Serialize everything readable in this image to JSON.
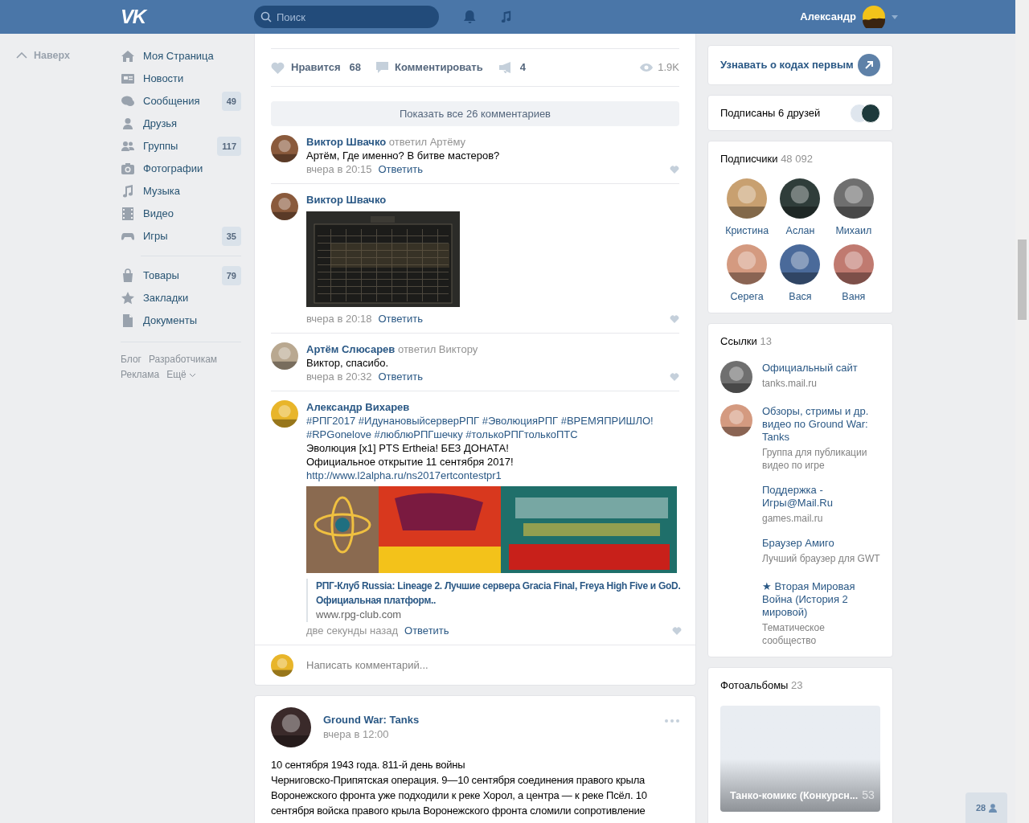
{
  "header": {
    "logo": "VK",
    "search": {
      "placeholder": "Поиск"
    },
    "user": "Александр"
  },
  "back_to_top": "Наверх",
  "nav": [
    [
      {
        "label": "Моя Страница"
      },
      {
        "label": "Новости"
      },
      {
        "label": "Сообщения",
        "count": "49"
      },
      {
        "label": "Друзья"
      },
      {
        "label": "Группы",
        "count": "117"
      },
      {
        "label": "Фотографии"
      },
      {
        "label": "Музыка"
      },
      {
        "label": "Видео"
      },
      {
        "label": "Игры",
        "count": "35"
      }
    ],
    [
      {
        "label": "Товары",
        "count": "79"
      },
      {
        "label": "Закладки"
      },
      {
        "label": "Документы"
      }
    ]
  ],
  "footer_links": [
    [
      "Блог",
      "Разработчикам"
    ],
    [
      "Реклама",
      "Ещё"
    ]
  ],
  "post": {
    "actions": {
      "like_label": "Нравится",
      "like_count": "68",
      "comment_label": "Комментировать",
      "share_count": "4",
      "views": "1.9K"
    },
    "show_all": "Показать все 26 комментариев",
    "comments": [
      {
        "author": "Виктор Швачко",
        "reply_to": "ответил Артёму",
        "lines": [
          {
            "kind": "text",
            "text": "Артём, Где именно? В битве мастеров?"
          }
        ],
        "time": "вчера в 20:15",
        "reply": "Ответить"
      },
      {
        "author": "Виктор Швачко",
        "time": "вчера в 20:18",
        "reply": "Ответить"
      },
      {
        "author": "Артём Слюсарев",
        "reply_to": "ответил Виктору",
        "lines": [
          {
            "kind": "text",
            "text": "Виктор, спасибо."
          }
        ],
        "time": "вчера в 20:32",
        "reply": "Ответить"
      },
      {
        "author": "Александр Вихарев",
        "lines": [
          {
            "kind": "hashtags",
            "text": "#РПГ2017 #ИдунановыйсерверРПГ #ЭволюцияРПГ #ВРЕМЯПРИШЛО!"
          },
          {
            "kind": "hashtags",
            "text": "#RPGonelove #люблюРПГшечку #толькоРПГтолькоПТС"
          },
          {
            "kind": "text",
            "text": "Эволюция [x1] PTS Ertheia! БЕЗ ДОНАТА!"
          },
          {
            "kind": "text",
            "text": "Официальное открытие 11 сентября 2017!"
          },
          {
            "kind": "link",
            "text": "http://www.l2alpha.ru/ns2017ertcontestpr1"
          }
        ],
        "attachment": {
          "kind": "banner",
          "title": "РПГ-Клуб Russia: Lineage 2. Лучшие сервера Gracia Final, Freya High Five и GoD. Официальная платформ..",
          "domain": "www.rpg-club.com"
        },
        "time": "две секунды назад",
        "reply": "Ответить"
      }
    ],
    "write_placeholder": "Написать комментарий..."
  },
  "post2": {
    "author": "Ground War: Tanks",
    "time": "вчера в 12:00",
    "lines": [
      "10 сентября 1943 года. 811-й день войны",
      "Черниговско-Припятская операция. 9—10 сентября соединения правого крыла",
      "Воронежского фронта уже подходили к реке Хорол, а центра — к реке Псёл. 10",
      "сентября войска правого крыла Воронежского фронта сломили сопротивление"
    ]
  },
  "right": {
    "subscribe": "Узнавать о кодах первым",
    "friends": "Подписаны 6 друзей",
    "followers": {
      "title": "Подписчики",
      "count": "48 092",
      "people": [
        "Кристина",
        "Аслан",
        "Михаил",
        "Серега",
        "Вася",
        "Ваня"
      ]
    },
    "links": {
      "title": "Ссылки",
      "count": "13",
      "items": [
        {
          "title": "Официальный сайт",
          "subtitle": "tanks.mail.ru",
          "avatar": true
        },
        {
          "title": "Обзоры, стримы и др. видео по Ground War: Tanks",
          "subtitle": "Группа для публикации видео по игре",
          "avatar": true
        },
        {
          "title": "Поддержка - Игры@Mail.Ru",
          "subtitle": "games.mail.ru",
          "avatar": false
        },
        {
          "title": "Браузер Амиго",
          "subtitle": "Лучший браузер для GWT",
          "avatar": false
        },
        {
          "title": "★ Вторая Мировая Война (История 2 мировой)",
          "subtitle": "Тематическое сообщество",
          "avatar": false
        }
      ]
    },
    "albums": {
      "title": "Фотоальбомы",
      "count": "23",
      "items": [
        {
          "name": "Танко-комикс (Конкурсн...",
          "count": "53"
        }
      ]
    }
  },
  "online_count": "28"
}
